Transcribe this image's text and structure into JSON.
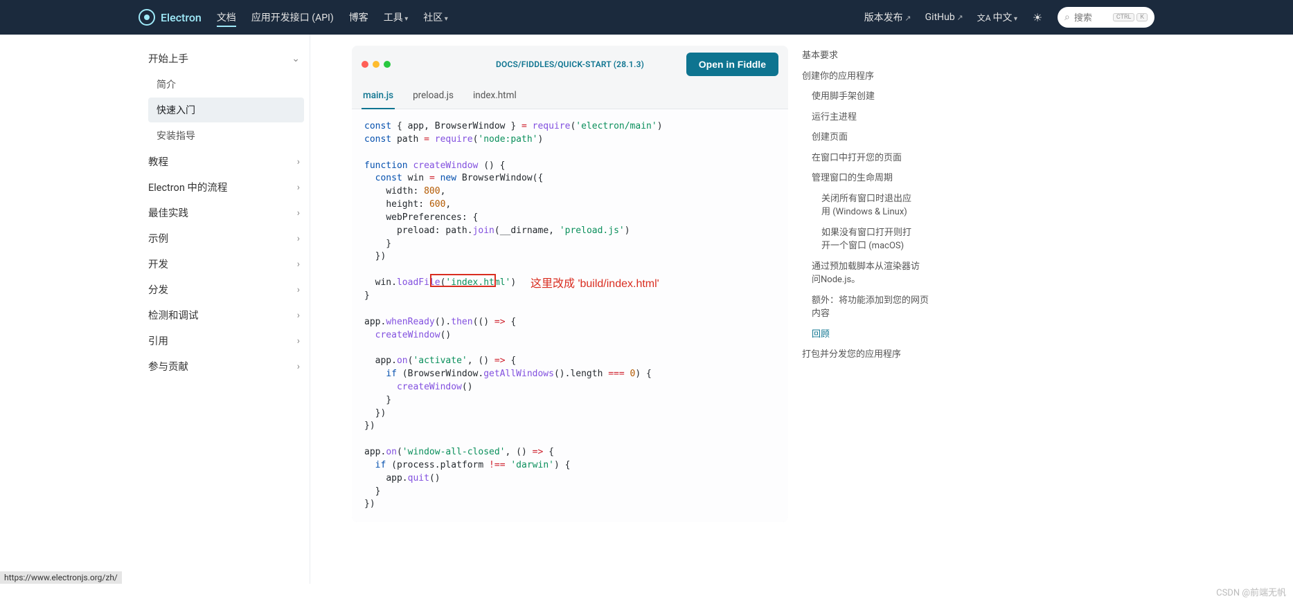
{
  "header": {
    "brand": "Electron",
    "nav": {
      "docs": "文档",
      "api": "应用开发接口 (API)",
      "blog": "博客",
      "tools": "工具",
      "community": "社区"
    },
    "right": {
      "releases": "版本发布",
      "github": "GitHub",
      "lang": "中文"
    },
    "search": {
      "placeholder": "搜索",
      "kbd1": "CTRL",
      "kbd2": "K"
    }
  },
  "sidebar": {
    "s0": {
      "title": "开始上手"
    },
    "subs": {
      "intro": "简介",
      "quickstart": "快速入门",
      "install": "安装指导"
    },
    "cats": {
      "tutorial": "教程",
      "process": "Electron 中的流程",
      "best": "最佳实践",
      "examples": "示例",
      "dev": "开发",
      "dist": "分发",
      "debug": "检测和调试",
      "ref": "引用",
      "contribute": "参与贡献"
    }
  },
  "code": {
    "title": "DOCS/FIDDLES/QUICK-START (28.1.3)",
    "fiddle_btn": "Open in Fiddle",
    "tabs": {
      "main": "main.js",
      "preload": "preload.js",
      "index": "index.html"
    },
    "annotation": "这里改成 'build/index.html'",
    "tokens": {
      "const": "const",
      "function": "function",
      "new": "new",
      "if": "if",
      "require": "require",
      "s_electron": "'electron/main'",
      "s_nodepath": "'node:path'",
      "s_preload": "'preload.js'",
      "s_index": "'index.html'",
      "s_activate": "'activate'",
      "s_winclosed": "'window-all-closed'",
      "s_darwin": "'darwin'",
      "n800": "800",
      "n600": "600",
      "n0": "0",
      "createWindow": "createWindow",
      "BrowserWindow": "BrowserWindow",
      "whenReady": "whenReady",
      "then": "then",
      "on": "on",
      "getAllWindows": "getAllWindows",
      "loadFile": "loadFile",
      "join": "join",
      "quit": "quit",
      "app": "app",
      "path": "path",
      "win": "win",
      "process": "process",
      "width": "width",
      "height": "height",
      "webPreferences": "webPreferences",
      "preload": "preload",
      "length": "length",
      "platform": "platform",
      "__dirname": "__dirname"
    }
  },
  "toc": {
    "i1": "基本要求",
    "i2": "创建你的应用程序",
    "i2a": "使用脚手架创建",
    "i2b": "运行主进程",
    "i2c": "创建页面",
    "i2d": "在窗口中打开您的页面",
    "i2e": "管理窗口的生命周期",
    "i2e1": "关闭所有窗口时退出应用 (Windows & Linux)",
    "i2e2": "如果没有窗口打开则打开一个窗口 (macOS)",
    "i2f": "通过预加载脚本从渲染器访问Node.js。",
    "i2g": "额外：将功能添加到您的网页内容",
    "i2h": "回顾",
    "i3": "打包并分发您的应用程序"
  },
  "status": "https://www.electronjs.org/zh/",
  "watermark": "CSDN @前端无帆"
}
